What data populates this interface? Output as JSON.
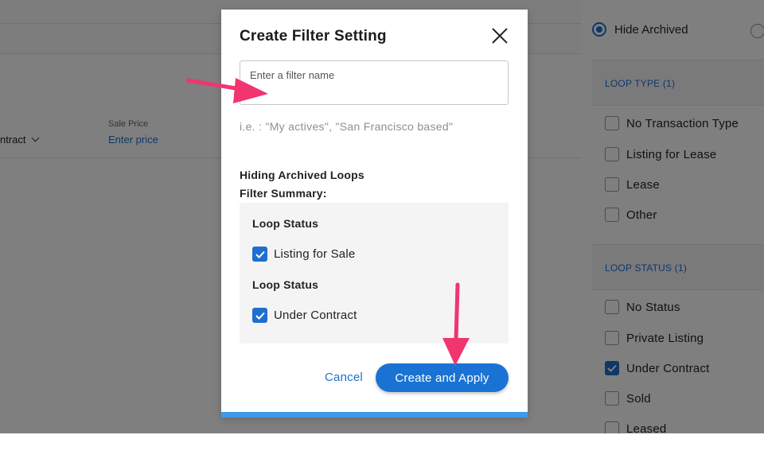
{
  "background": {
    "contract_dropdown": "ntract",
    "sale_price_label": "Sale Price",
    "sale_price_placeholder": "Enter price"
  },
  "sidebar": {
    "archived_option": "Hide Archived",
    "loop_type": {
      "heading": "LOOP TYPE (1)",
      "items": [
        {
          "label": "No Transaction Type",
          "checked": false
        },
        {
          "label": "Listing for Lease",
          "checked": false
        },
        {
          "label": "Lease",
          "checked": false
        },
        {
          "label": "Other",
          "checked": false
        }
      ]
    },
    "loop_status": {
      "heading": "LOOP STATUS (1)",
      "items": [
        {
          "label": "No Status",
          "checked": false
        },
        {
          "label": "Private Listing",
          "checked": false
        },
        {
          "label": "Under Contract",
          "checked": true
        },
        {
          "label": "Sold",
          "checked": false
        },
        {
          "label": "Leased",
          "checked": false
        }
      ]
    }
  },
  "modal": {
    "title": "Create Filter Setting",
    "name_input_placeholder": "Enter a filter name",
    "name_input_value": "",
    "hint": "i.e. : \"My actives\", \"San Francisco based\"",
    "archived_text": "Hiding Archived Loops",
    "summary_label": "Filter Summary:",
    "summary": [
      {
        "heading": "Loop Status",
        "item": "Listing for Sale",
        "checked": true
      },
      {
        "heading": "Loop Status",
        "item": "Under Contract",
        "checked": true
      }
    ],
    "cancel_label": "Cancel",
    "apply_label": "Create and Apply"
  },
  "colors": {
    "accent": "#1e6fd0",
    "annotation_arrow": "#f0356f",
    "modal_bottom_bar": "#3d9be9"
  }
}
